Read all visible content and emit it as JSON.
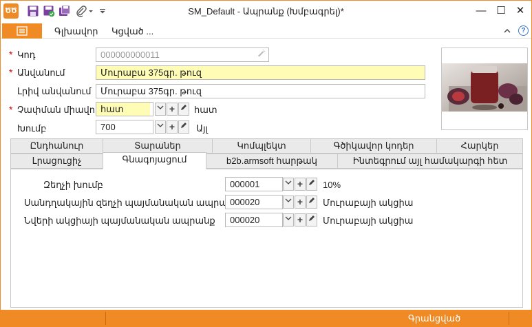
{
  "window": {
    "title": "SM_Default - Ապրանք (Խմբագրել)*",
    "app_logo": "ԾԾ",
    "minimize": "—",
    "maximize": "☐",
    "close": "✕"
  },
  "menu": {
    "items": [
      "Գլխավոր",
      "Կցված ..."
    ],
    "help": "?"
  },
  "form": {
    "code": {
      "label": "Կոդ",
      "required": true,
      "value": "000000000011"
    },
    "name": {
      "label": "Անվանում",
      "required": true,
      "value": "Մուրաբա 375գր. թուզ"
    },
    "full_name": {
      "label": "Լրիվ անվանում",
      "value": "Մուրաբա 375գր. թուզ"
    },
    "unit": {
      "label": "Չափման միավոր",
      "required": true,
      "value": "հատ",
      "display": "հատ"
    },
    "group": {
      "label": "Խումբ",
      "value": "700",
      "display": "Այլ"
    }
  },
  "tabs_row1": [
    "Ընդհանուր",
    "Տարաներ",
    "Կոմպլեկտ",
    "Գծիկավոր կոդեր",
    "Հարկեր"
  ],
  "tabs_row2": [
    "Լրացուցիչ",
    "Գնագոյացում",
    "b2b.armsoft հարթակ",
    "Ինտեգրում այլ համակարգի հետ"
  ],
  "active_tab": "Գնագոյացում",
  "pricing": {
    "rows": [
      {
        "label": "Զեղչի խումբ",
        "value": "000001",
        "display": "10%"
      },
      {
        "label": "Սանդղակային զեղչի պայմանական ապրանք",
        "value": "000020",
        "display": "Մուրաբայի ակցիա"
      },
      {
        "label": "Նվերի ակցիայի պայմանական ապրանք",
        "value": "000020",
        "display": "Մուրաբայի ակցիա"
      }
    ]
  },
  "status": {
    "text": "Գրանցված"
  },
  "colors": {
    "accent": "#f08a24",
    "required_bg": "#fffcb5",
    "required_mark": "#dd0000"
  }
}
